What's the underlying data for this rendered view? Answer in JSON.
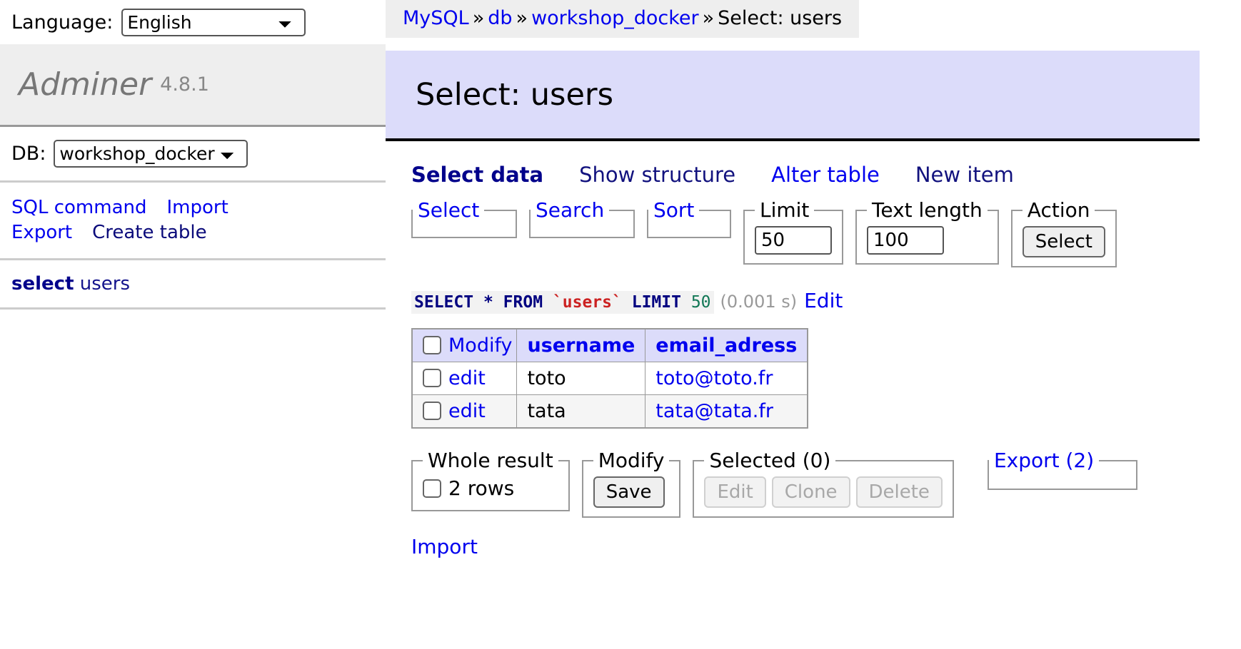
{
  "language_bar": {
    "label": "Language:",
    "selected": "English",
    "options": [
      "English"
    ]
  },
  "sidebar": {
    "logo": {
      "name": "Adminer",
      "version": "4.8.1"
    },
    "db": {
      "label": "DB:",
      "selected": "workshop_docker",
      "options": [
        "workshop_docker"
      ]
    },
    "links": [
      {
        "label": "SQL command",
        "state": "link"
      },
      {
        "label": "Import",
        "state": "link"
      },
      {
        "label": "Export",
        "state": "link"
      },
      {
        "label": "Create table",
        "state": "visited"
      }
    ],
    "current_action": {
      "verb": "select",
      "table": "users"
    }
  },
  "breadcrumb": {
    "items": [
      {
        "label": "MySQL",
        "type": "link"
      },
      {
        "label": "db",
        "type": "link"
      },
      {
        "label": "workshop_docker",
        "type": "link"
      },
      {
        "label": "Select: users",
        "type": "current"
      }
    ],
    "separator": "»"
  },
  "page": {
    "title": "Select: users"
  },
  "tabs": [
    {
      "label": "Select data",
      "state": "active"
    },
    {
      "label": "Show structure",
      "state": "visited"
    },
    {
      "label": "Alter table",
      "state": "link"
    },
    {
      "label": "New item",
      "state": "visited"
    }
  ],
  "query_controls": {
    "select": {
      "legend": "Select"
    },
    "search": {
      "legend": "Search"
    },
    "sort": {
      "legend": "Sort"
    },
    "limit": {
      "legend": "Limit",
      "value": "50"
    },
    "text_length": {
      "legend": "Text length",
      "value": "100"
    },
    "action": {
      "legend": "Action",
      "button": "Select"
    }
  },
  "sql": {
    "keyword_select": "SELECT",
    "star": "*",
    "keyword_from": "FROM",
    "table": "`users`",
    "keyword_limit": "LIMIT",
    "limit_value": "50",
    "time": "(0.001 s)",
    "edit_link": "Edit"
  },
  "results": {
    "modify_header": "Modify",
    "columns": [
      "username",
      "email_adress"
    ],
    "rows": [
      {
        "action": "edit",
        "username": "toto",
        "email_adress": "toto@toto.fr"
      },
      {
        "action": "edit",
        "username": "tata",
        "email_adress": "tata@tata.fr"
      }
    ]
  },
  "footer_controls": {
    "whole_result": {
      "legend": "Whole result",
      "rows_label": "2 rows"
    },
    "modify": {
      "legend": "Modify",
      "save_button": "Save"
    },
    "selected": {
      "legend": "Selected (0)",
      "buttons": [
        {
          "label": "Edit",
          "disabled": true
        },
        {
          "label": "Clone",
          "disabled": true
        },
        {
          "label": "Delete",
          "disabled": true
        }
      ]
    },
    "export": {
      "legend": "Export (2)"
    },
    "import_link": "Import"
  },
  "colors": {
    "link": "#0000ee",
    "visited": "#12127e",
    "title_bg": "#dcdcfa",
    "breadcrumb_bg": "#eeeeee",
    "logo_bg": "#eeeeee",
    "sql_keyword": "#000080",
    "sql_table": "#cc2222",
    "sql_number": "#117755"
  }
}
